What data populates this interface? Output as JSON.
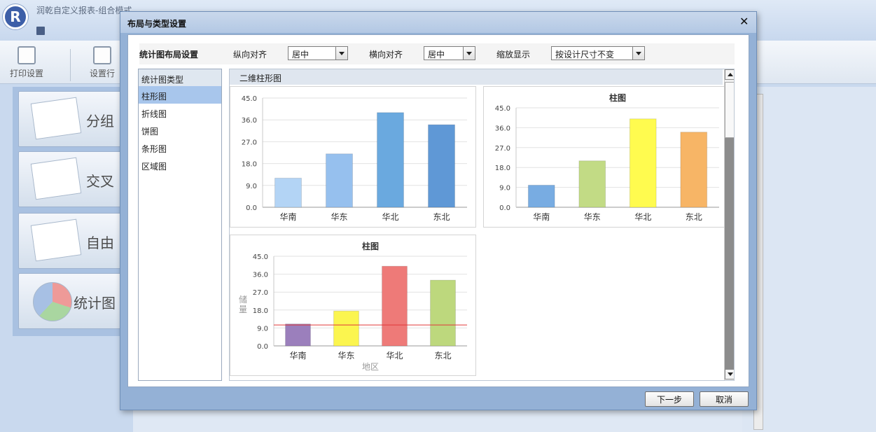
{
  "app": {
    "title": "润乾自定义报表-组合模式",
    "toolbar": [
      {
        "label": "打印设置"
      },
      {
        "label": "设置行"
      }
    ],
    "modes": [
      {
        "label": "分组"
      },
      {
        "label": "交叉"
      },
      {
        "label": "自由"
      },
      {
        "label": "统计图"
      }
    ]
  },
  "dialog": {
    "title": "布局与类型设置",
    "close": "✕",
    "layout": {
      "title": "统计图布局设置",
      "vertical_label": "纵向对齐",
      "vertical_value": "居中",
      "horizontal_label": "横向对齐",
      "horizontal_value": "居中",
      "zoom_label": "缩放显示",
      "zoom_value": "按设计尺寸不变"
    },
    "type_list": {
      "header": "统计图类型",
      "items": [
        "柱形图",
        "折线图",
        "饼图",
        "条形图",
        "区域图"
      ],
      "selected": 0
    },
    "preview_header": "二维柱形图",
    "buttons": {
      "next": "下一步",
      "cancel": "取消"
    }
  },
  "chart_data": [
    {
      "type": "bar",
      "title": "",
      "categories": [
        "华南",
        "华东",
        "华北",
        "东北"
      ],
      "values": [
        12,
        22,
        39,
        34
      ],
      "colors": [
        "#b3d4f5",
        "#96c0ee",
        "#6aa9df",
        "#5f98d6"
      ],
      "ylim": [
        0,
        45
      ],
      "yticks": [
        "0.0",
        "9.0",
        "18.0",
        "27.0",
        "36.0",
        "45.0"
      ],
      "xlabel": "",
      "ylabel": ""
    },
    {
      "type": "bar",
      "title": "柱图",
      "categories": [
        "华南",
        "华东",
        "华北",
        "东北"
      ],
      "values": [
        10,
        21,
        40,
        34
      ],
      "colors": [
        "#78ace2",
        "#c2db85",
        "#fffb4f",
        "#f7b566"
      ],
      "ylim": [
        0,
        45
      ],
      "yticks": [
        "0.0",
        "9.0",
        "18.0",
        "27.0",
        "36.0",
        "45.0"
      ],
      "xlabel": "",
      "ylabel": ""
    },
    {
      "type": "bar",
      "title": "柱图",
      "categories": [
        "华南",
        "华东",
        "华北",
        "东北"
      ],
      "values": [
        11,
        17.5,
        40,
        33
      ],
      "colors": [
        "#9b7fbc",
        "#fbf54f",
        "#ee7a78",
        "#bdd87d"
      ],
      "ylim": [
        0,
        45
      ],
      "yticks": [
        "0.0",
        "9.0",
        "18.0",
        "27.0",
        "36.0",
        "45.0"
      ],
      "xlabel": "地区",
      "ylabel": "储量",
      "reference_line": 10.5,
      "reference_color": "#e0393a"
    }
  ]
}
